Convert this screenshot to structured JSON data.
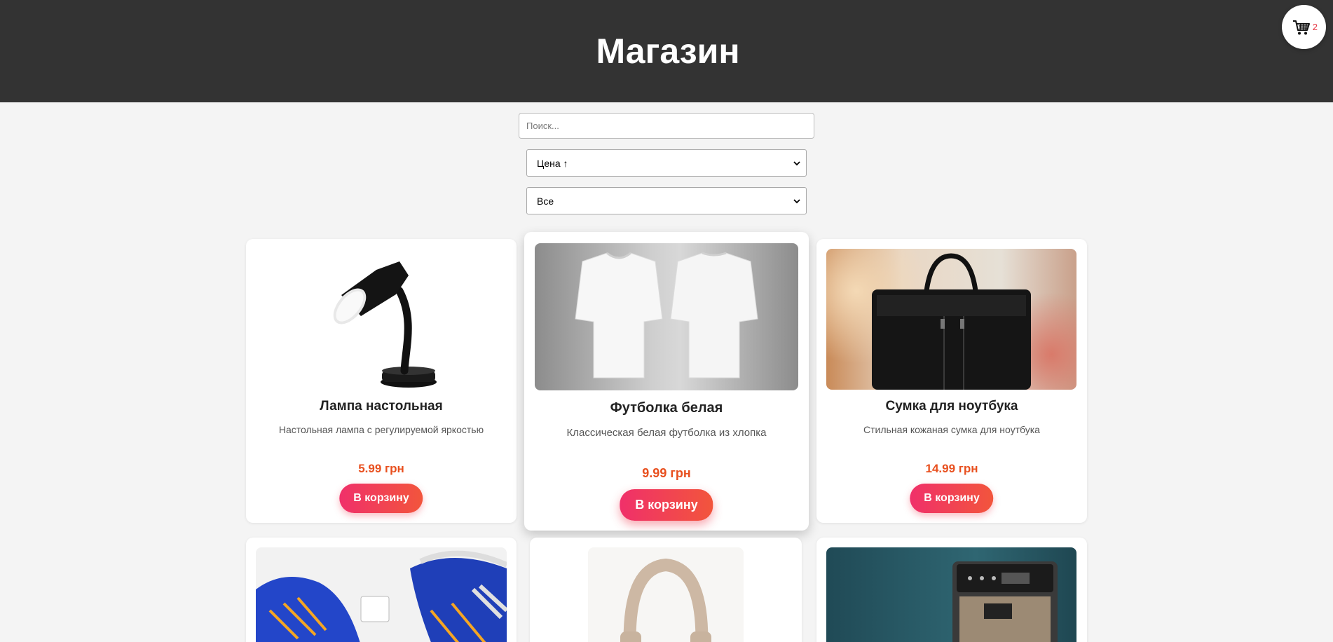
{
  "header": {
    "title": "Магазин"
  },
  "cart": {
    "count": "2",
    "icon": "cart-icon"
  },
  "search": {
    "placeholder": "Поиск...",
    "value": ""
  },
  "sort": {
    "selected": "Цена ↑"
  },
  "category": {
    "selected": "Все"
  },
  "products": [
    {
      "title": "Лампа настольная",
      "description": "Настольная лампа с регулируемой яркостью",
      "price": "5.99 грн",
      "button": "В корзину",
      "image": "desk-lamp"
    },
    {
      "title": "Футболка белая",
      "description": "Классическая белая футболка из хлопка",
      "price": "9.99 грн",
      "button": "В корзину",
      "image": "white-t-shirts"
    },
    {
      "title": "Сумка для ноутбука",
      "description": "Стильная кожаная сумка для ноутбука",
      "price": "14.99 грн",
      "button": "В корзину",
      "image": "leather-laptop-bag"
    },
    {
      "image": "blue-sneakers"
    },
    {
      "image": "beige-headphones"
    },
    {
      "image": "coffee-machine"
    }
  ],
  "colors": {
    "header_bg": "#333333",
    "page_bg": "#f4f4f4",
    "price": "#e8501f",
    "button_from": "#f0306a",
    "button_to": "#f2553c"
  }
}
